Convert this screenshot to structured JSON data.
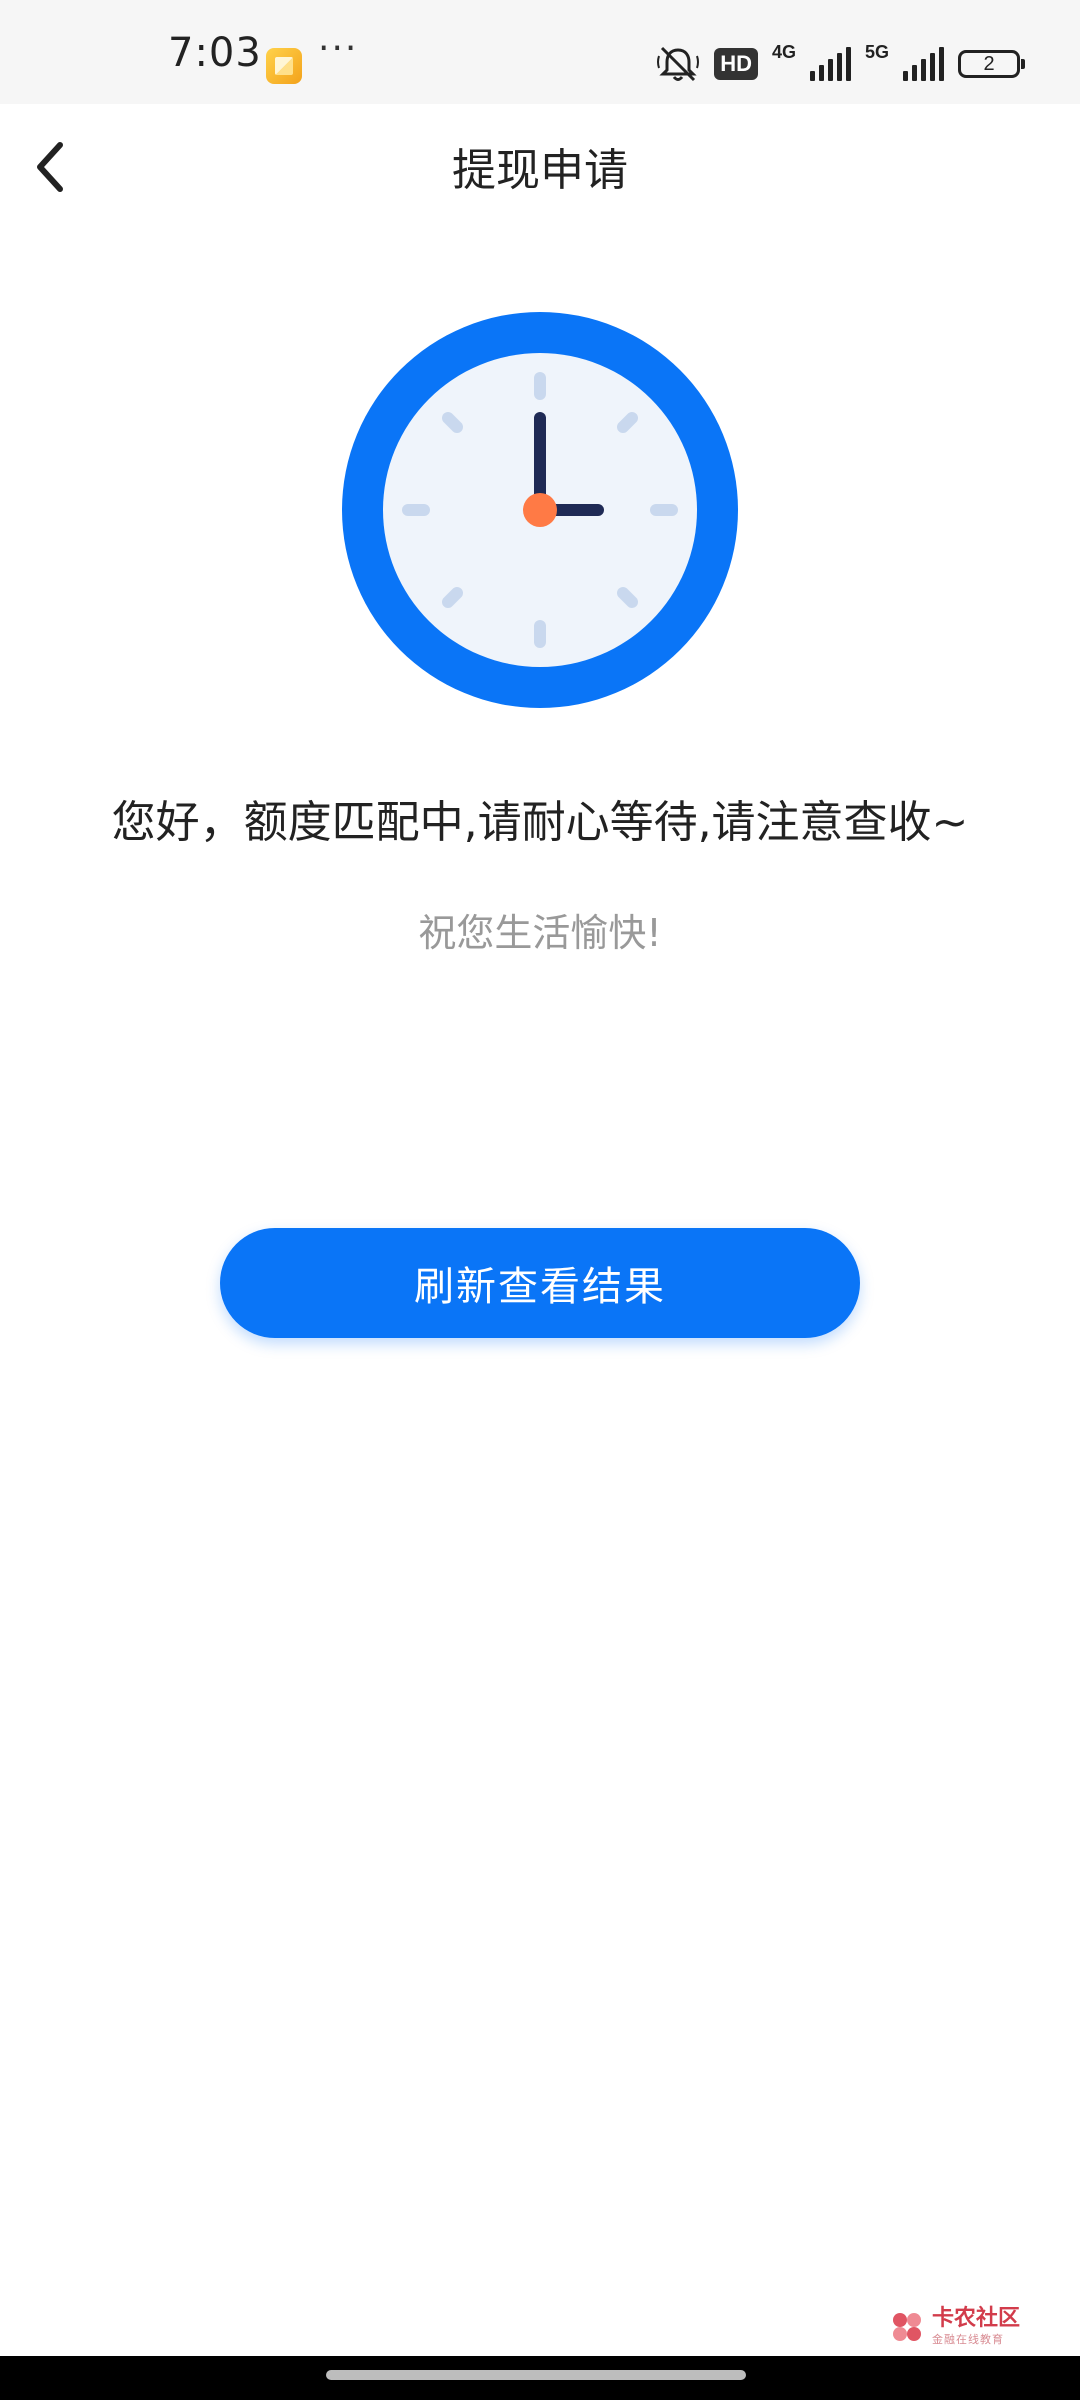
{
  "status_bar": {
    "time": "7:03",
    "more": "···",
    "hd_badge": "HD",
    "network_1": "4G",
    "network_2": "5G",
    "battery_level": "2"
  },
  "header": {
    "title": "提现申请"
  },
  "content": {
    "message": "您好，额度匹配中,请耐心等待,请注意查收~",
    "sub_message": "祝您生活愉快!"
  },
  "actions": {
    "refresh_label": "刷新查看结果"
  },
  "watermark": {
    "name": "卡农社区",
    "slogan": "金融在线教育"
  },
  "colors": {
    "accent": "#0a75f7",
    "clock_ring": "#0a75f7",
    "clock_face": "#eff4fb",
    "clock_hands": "#1f2a55",
    "clock_center": "#ff7a45"
  },
  "icons": {
    "back": "chevron-left-icon",
    "clock": "clock-icon",
    "mute": "bell-mute-icon"
  }
}
